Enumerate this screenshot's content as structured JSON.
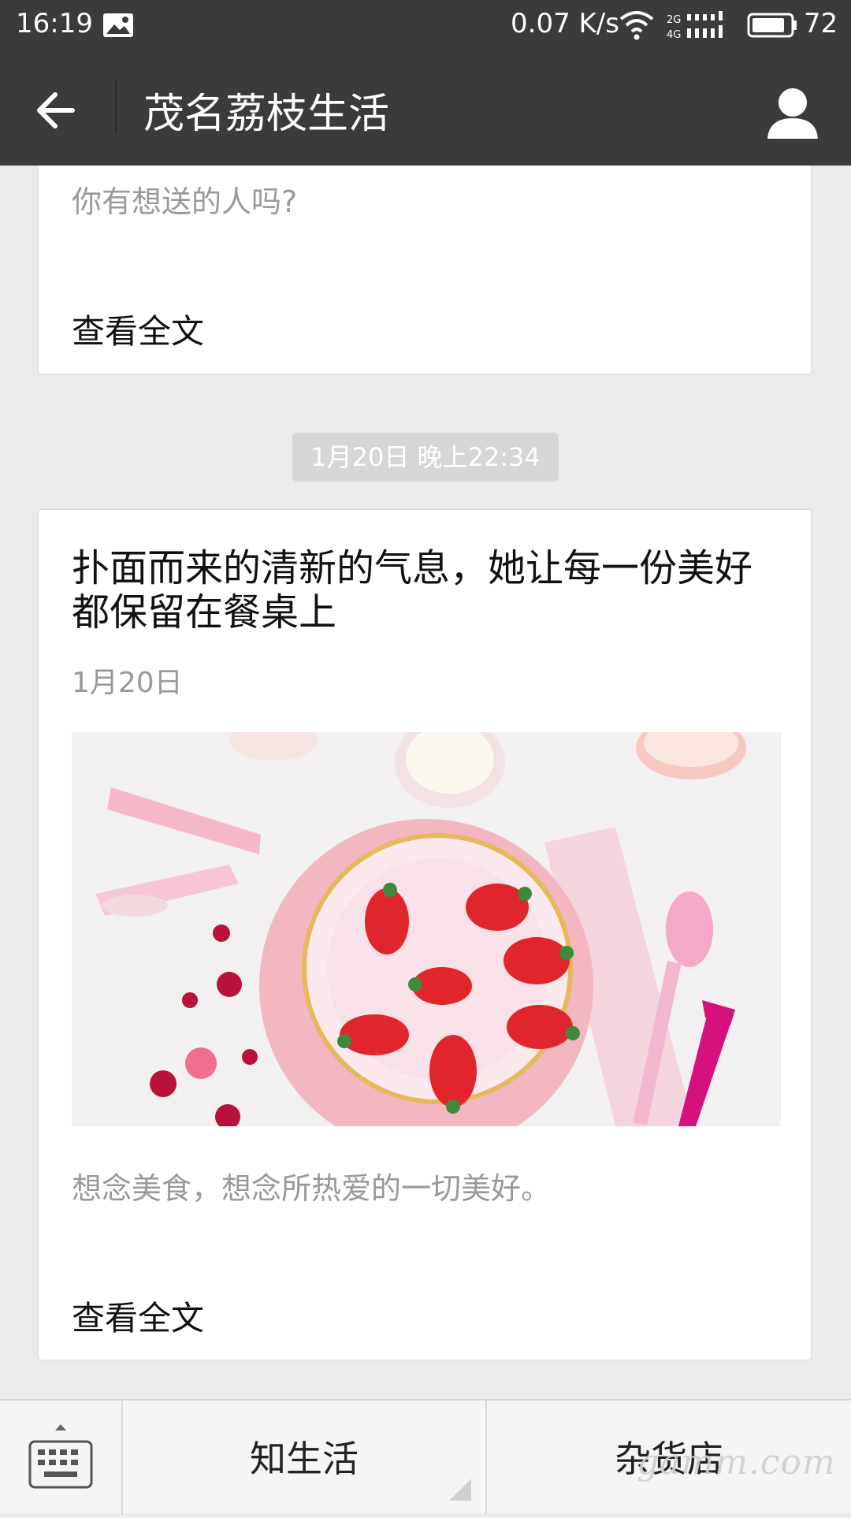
{
  "status_bar": {
    "time": "16:19",
    "net_speed": "0.07 K/s",
    "battery_level": "72",
    "icons": [
      "image-notification-icon",
      "wifi-icon",
      "cellular-2g-4g-icon",
      "battery-icon"
    ]
  },
  "header": {
    "title": "茂名荔枝生活",
    "back_icon": "arrow-left-icon",
    "profile_icon": "person-icon"
  },
  "messages": [
    {
      "summary_partial_line": "",
      "summary": "你有想送的人吗?",
      "read_more": "查看全文"
    },
    {
      "timestamp": "1月20日 晚上22:34",
      "headline": "扑面而来的清新的气息，她让每一份美好都保留在餐桌上",
      "date": "1月20日",
      "cover_image": "strawberries-on-pink-plate",
      "summary": "想念美食，想念所热爱的一切美好。",
      "read_more": "查看全文"
    }
  ],
  "bottom_menu": {
    "keyboard_icon": "keyboard-icon",
    "items": [
      {
        "label": "知生活",
        "has_submenu": true
      },
      {
        "label": "杂货店",
        "has_submenu": false
      }
    ]
  },
  "watermark": "gamm.com",
  "colors": {
    "header_bg": "#3a3b3d",
    "page_bg": "#ebebeb",
    "card_bg": "#ffffff",
    "timestamp_bg": "#d6d6d6"
  }
}
